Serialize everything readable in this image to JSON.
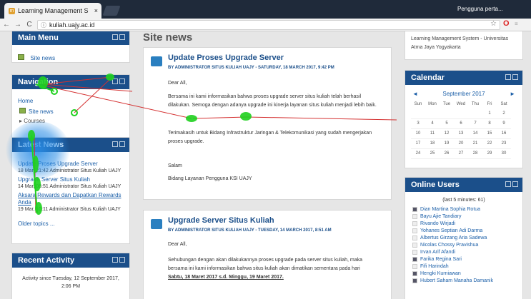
{
  "browser": {
    "tab_title": "Learning Management S",
    "tab_close": "×",
    "profile": "Pengguna perta...",
    "url": "kuliah.uajy.ac.id",
    "back": "←",
    "forward": "→",
    "reload": "C"
  },
  "left": {
    "main_menu": {
      "title": "Main Menu",
      "item": "Site news"
    },
    "navigation": {
      "title": "Navigation",
      "home": "Home",
      "site_news": "Site news",
      "courses": "Courses"
    },
    "latest_news": {
      "title": "Latest News",
      "items": [
        {
          "link": "Update Proses Upgrade Server",
          "meta": "18 Mar, 21:42  Administrator Situs Kuliah UAJY"
        },
        {
          "link": "Upgrade Server Situs Kuliah",
          "meta": "14 Mar, 08:51  Administrator Situs Kuliah UAJY"
        },
        {
          "link": "Aksara Rewards dan Dapatkan Rewards Anda",
          "meta": "19 Mar, 10:11  Administrator Situs Kuliah UAJY"
        }
      ],
      "older": "Older topics ..."
    },
    "recent_activity": {
      "title": "Recent Activity",
      "since": "Activity since Tuesday, 12 September 2017,",
      "time": "2:06 PM"
    }
  },
  "center": {
    "heading": "Site news",
    "posts": [
      {
        "title": "Update Proses Upgrade Server",
        "by": "BY ADMINISTRATOR SITUS KULIAH UAJY - SATURDAY, 18 MARCH 2017, 9:42 PM",
        "body": [
          "Dear All,",
          "Bersama ini kami informasikan bahwa proses upgrade server situs kuliah telah berhasil",
          "dilakukan. Semoga dengan adanya upgrade ini kinerja layanan situs kuliah menjadi lebih baik.",
          "Terimakasih untuk Bidang Infrastruktur Jaringan & Telekomunikasi yang sudah mengerjakan",
          "proses upgrade.",
          "Salam",
          "Bidang Layanan Pengguna KSI UAJY"
        ]
      },
      {
        "title": "Upgrade Server Situs Kuliah",
        "by": "BY ADMINISTRATOR SITUS KULIAH UAJY - TUESDAY, 14 MARCH 2017, 8:51 AM",
        "body": [
          "Dear All,",
          "Sehubungan dengan akan dilakukannya proses upgrade pada server situs kuliah, maka",
          "bersama ini kami informasikan bahwa situs kuliah akan dimatikan sementara pada hari",
          "Sabtu, 18 Maret 2017 s.d. Minggu, 19 Maret 2017."
        ]
      }
    ]
  },
  "right": {
    "about": "Learning Management System - Universitas Atma Jaya Yogyakarta",
    "calendar": {
      "title": "Calendar",
      "month": "September 2017",
      "prev": "◄",
      "next": "►",
      "days": [
        "Sun",
        "Mon",
        "Tue",
        "Wed",
        "Thu",
        "Fri",
        "Sat"
      ],
      "weeks": [
        [
          "",
          "",
          "",
          "",
          "",
          "1",
          "2"
        ],
        [
          "3",
          "4",
          "5",
          "6",
          "7",
          "8",
          "9"
        ],
        [
          "10",
          "11",
          "12",
          "13",
          "14",
          "15",
          "16"
        ],
        [
          "17",
          "18",
          "19",
          "20",
          "21",
          "22",
          "23"
        ],
        [
          "24",
          "25",
          "26",
          "27",
          "28",
          "29",
          "30"
        ]
      ]
    },
    "online_users": {
      "title": "Online Users",
      "subtitle": "(last 5 minutes: 61)",
      "users": [
        "Dian Martina Sophia Rotua",
        "Bayu Ajie Tandiary",
        "Rivando Wirjadi",
        "Yohanes Septian Adi Darma",
        "Albertus Girzang Aria Sadewa",
        "Nicolas Chossy Pravishua",
        "Irvan Arif Afandi",
        "Farika Regina Sari",
        "Fifi Harindah",
        "Hengki Kurniawan",
        "Hubert Saham Manaha Damanik"
      ]
    }
  },
  "icons": {
    "favicon": "moodle-favicon",
    "star": "☆",
    "opera": "O",
    "more": "≡"
  },
  "colors": {
    "block_header": "#1b4f8a",
    "gaze": "#1fd11f",
    "gaze_line": "#d43030",
    "focus_glow": "#288ce6"
  }
}
